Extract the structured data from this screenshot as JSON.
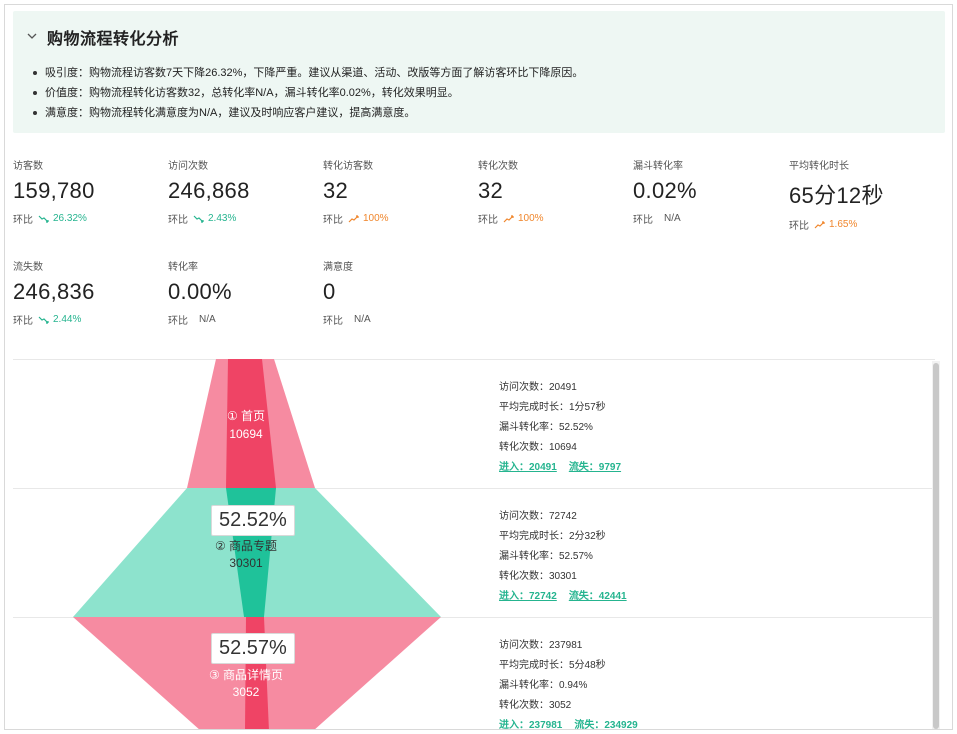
{
  "summary": {
    "title": "购物流程转化分析",
    "items": [
      "吸引度：购物流程访客数7天下降26.32%，下降严重。建议从渠道、活动、改版等方面了解访客环比下降原因。",
      "价值度：购物流程转化访客数32，总转化率N/A，漏斗转化率0.02%，转化效果明显。",
      "满意度：购物流程转化满意度为N/A，建议及时响应客户建议，提高满意度。"
    ]
  },
  "metrics": [
    {
      "label": "访客数",
      "value": "159,780",
      "comp_label": "环比",
      "trend": "down",
      "change": "26.32%"
    },
    {
      "label": "访问次数",
      "value": "246,868",
      "comp_label": "环比",
      "trend": "down",
      "change": "2.43%"
    },
    {
      "label": "转化访客数",
      "value": "32",
      "comp_label": "环比",
      "trend": "up",
      "change": "100%"
    },
    {
      "label": "转化次数",
      "value": "32",
      "comp_label": "环比",
      "trend": "up",
      "change": "100%"
    },
    {
      "label": "漏斗转化率",
      "value": "0.02%",
      "comp_label": "环比",
      "trend": "none",
      "change": "N/A"
    },
    {
      "label": "平均转化时长",
      "value": "65分12秒",
      "comp_label": "环比",
      "trend": "up",
      "change": "1.65%"
    },
    {
      "label": "流失数",
      "value": "246,836",
      "comp_label": "环比",
      "trend": "down",
      "change": "2.44%"
    },
    {
      "label": "转化率",
      "value": "0.00%",
      "comp_label": "环比",
      "trend": "none",
      "change": "N/A"
    },
    {
      "label": "满意度",
      "value": "0",
      "comp_label": "环比",
      "trend": "none",
      "change": "N/A"
    }
  ],
  "colors": {
    "pink_outer": "#f68ba1",
    "pink_inner": "#ef4465",
    "green_outer": "#8de3cd",
    "green_inner": "#1fc29a",
    "accent_green": "#25b48f",
    "accent_orange": "#f0862c"
  },
  "funnel": {
    "stages": [
      {
        "name": "① 首页",
        "count": "10694",
        "rate_box": "",
        "details": [
          {
            "k": "访问次数：",
            "v": "20491"
          },
          {
            "k": "平均完成时长：",
            "v": "1分57秒"
          },
          {
            "k": "漏斗转化率：",
            "v": "52.52%"
          },
          {
            "k": "转化次数：",
            "v": "10694"
          }
        ],
        "enter": "进入：20491",
        "lost": "流失：9797"
      },
      {
        "name": "② 商品专题",
        "count": "30301",
        "rate_box": "52.52%",
        "details": [
          {
            "k": "访问次数：",
            "v": "72742"
          },
          {
            "k": "平均完成时长：",
            "v": "2分32秒"
          },
          {
            "k": "漏斗转化率：",
            "v": "52.57%"
          },
          {
            "k": "转化次数：",
            "v": "30301"
          }
        ],
        "enter": "进入：72742",
        "lost": "流失：42441"
      },
      {
        "name": "③ 商品详情页",
        "count": "3052",
        "rate_box": "52.57%",
        "details": [
          {
            "k": "访问次数：",
            "v": "237981"
          },
          {
            "k": "平均完成时长：",
            "v": "5分48秒"
          },
          {
            "k": "漏斗转化率：",
            "v": "0.94%"
          },
          {
            "k": "转化次数：",
            "v": "3052"
          }
        ],
        "enter": "进入：237981",
        "lost": "流失：234929"
      }
    ]
  }
}
